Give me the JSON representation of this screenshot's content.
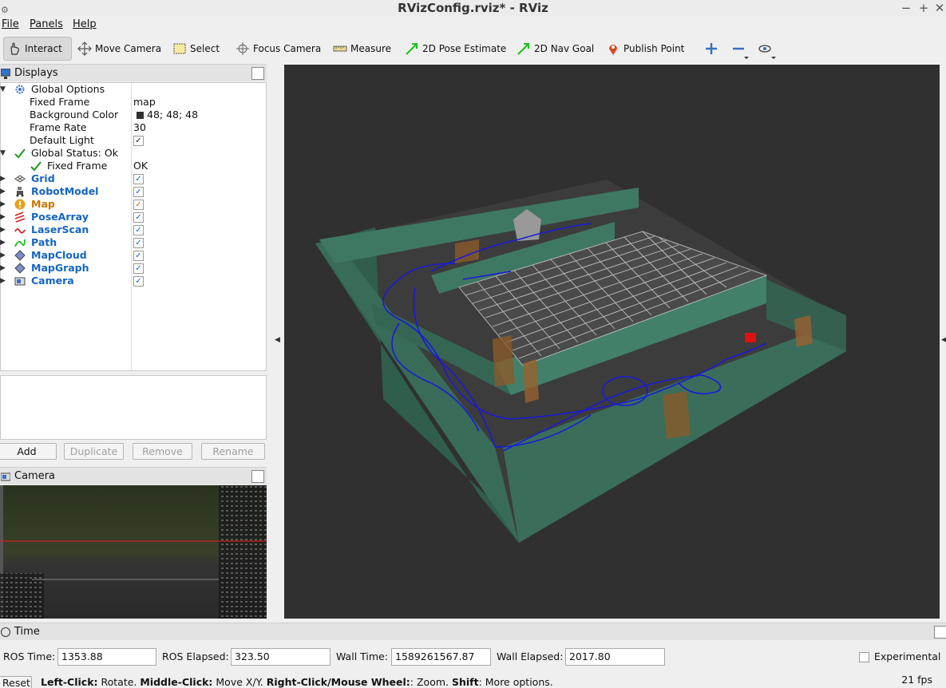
{
  "window": {
    "title": "RVizConfig.rviz* - RViz",
    "minimize": "−",
    "maximize": "+",
    "close": "✕"
  },
  "menu": {
    "file": "File",
    "panels": "Panels",
    "help": "Help"
  },
  "toolbar": {
    "interact": "Interact",
    "move_camera": "Move Camera",
    "select": "Select",
    "focus_camera": "Focus Camera",
    "measure": "Measure",
    "pose_estimate": "2D Pose Estimate",
    "nav_goal": "2D Nav Goal",
    "publish_point": "Publish Point"
  },
  "displays": {
    "title": "Displays",
    "global_options": {
      "label": "Global Options",
      "fixed_frame_label": "Fixed Frame",
      "fixed_frame_value": "map",
      "bg_label": "Background Color",
      "bg_value": "48; 48; 48",
      "frame_rate_label": "Frame Rate",
      "frame_rate_value": "30",
      "default_light_label": "Default Light"
    },
    "global_status": {
      "label": "Global Status: Ok",
      "fixed_frame_label": "Fixed Frame",
      "fixed_frame_value": "OK"
    },
    "items": [
      {
        "label": "Grid",
        "checked": true
      },
      {
        "label": "RobotModel",
        "checked": true
      },
      {
        "label": "Map",
        "checked": true
      },
      {
        "label": "PoseArray",
        "checked": true
      },
      {
        "label": "LaserScan",
        "checked": true
      },
      {
        "label": "Path",
        "checked": true
      },
      {
        "label": "MapCloud",
        "checked": true
      },
      {
        "label": "MapGraph",
        "checked": true
      },
      {
        "label": "Camera",
        "checked": true
      }
    ],
    "buttons": {
      "add": "Add",
      "duplicate": "Duplicate",
      "remove": "Remove",
      "rename": "Rename"
    }
  },
  "camera_panel": {
    "title": "Camera"
  },
  "time": {
    "title": "Time",
    "ros_time_label": "ROS Time:",
    "ros_time": "1353.88",
    "ros_elapsed_label": "ROS Elapsed:",
    "ros_elapsed": "323.50",
    "wall_time_label": "Wall Time:",
    "wall_time": "1589261567.87",
    "wall_elapsed_label": "Wall Elapsed:",
    "wall_elapsed": "2017.80",
    "experimental": "Experimental"
  },
  "status": {
    "reset": "Reset",
    "hint_parts": [
      "Left-Click:",
      " Rotate. ",
      "Middle-Click:",
      " Move X/Y. ",
      "Right-Click/Mouse Wheel:",
      ": Zoom. ",
      "Shift",
      ": More options."
    ],
    "fps": "21 fps"
  },
  "colors": {
    "background": "#303030",
    "wall": "#3a6e5a",
    "path": "#1a1ad8",
    "grid": "#bfbfbf",
    "accent_blue": "#1565c0",
    "map_warning": "#c77700"
  }
}
